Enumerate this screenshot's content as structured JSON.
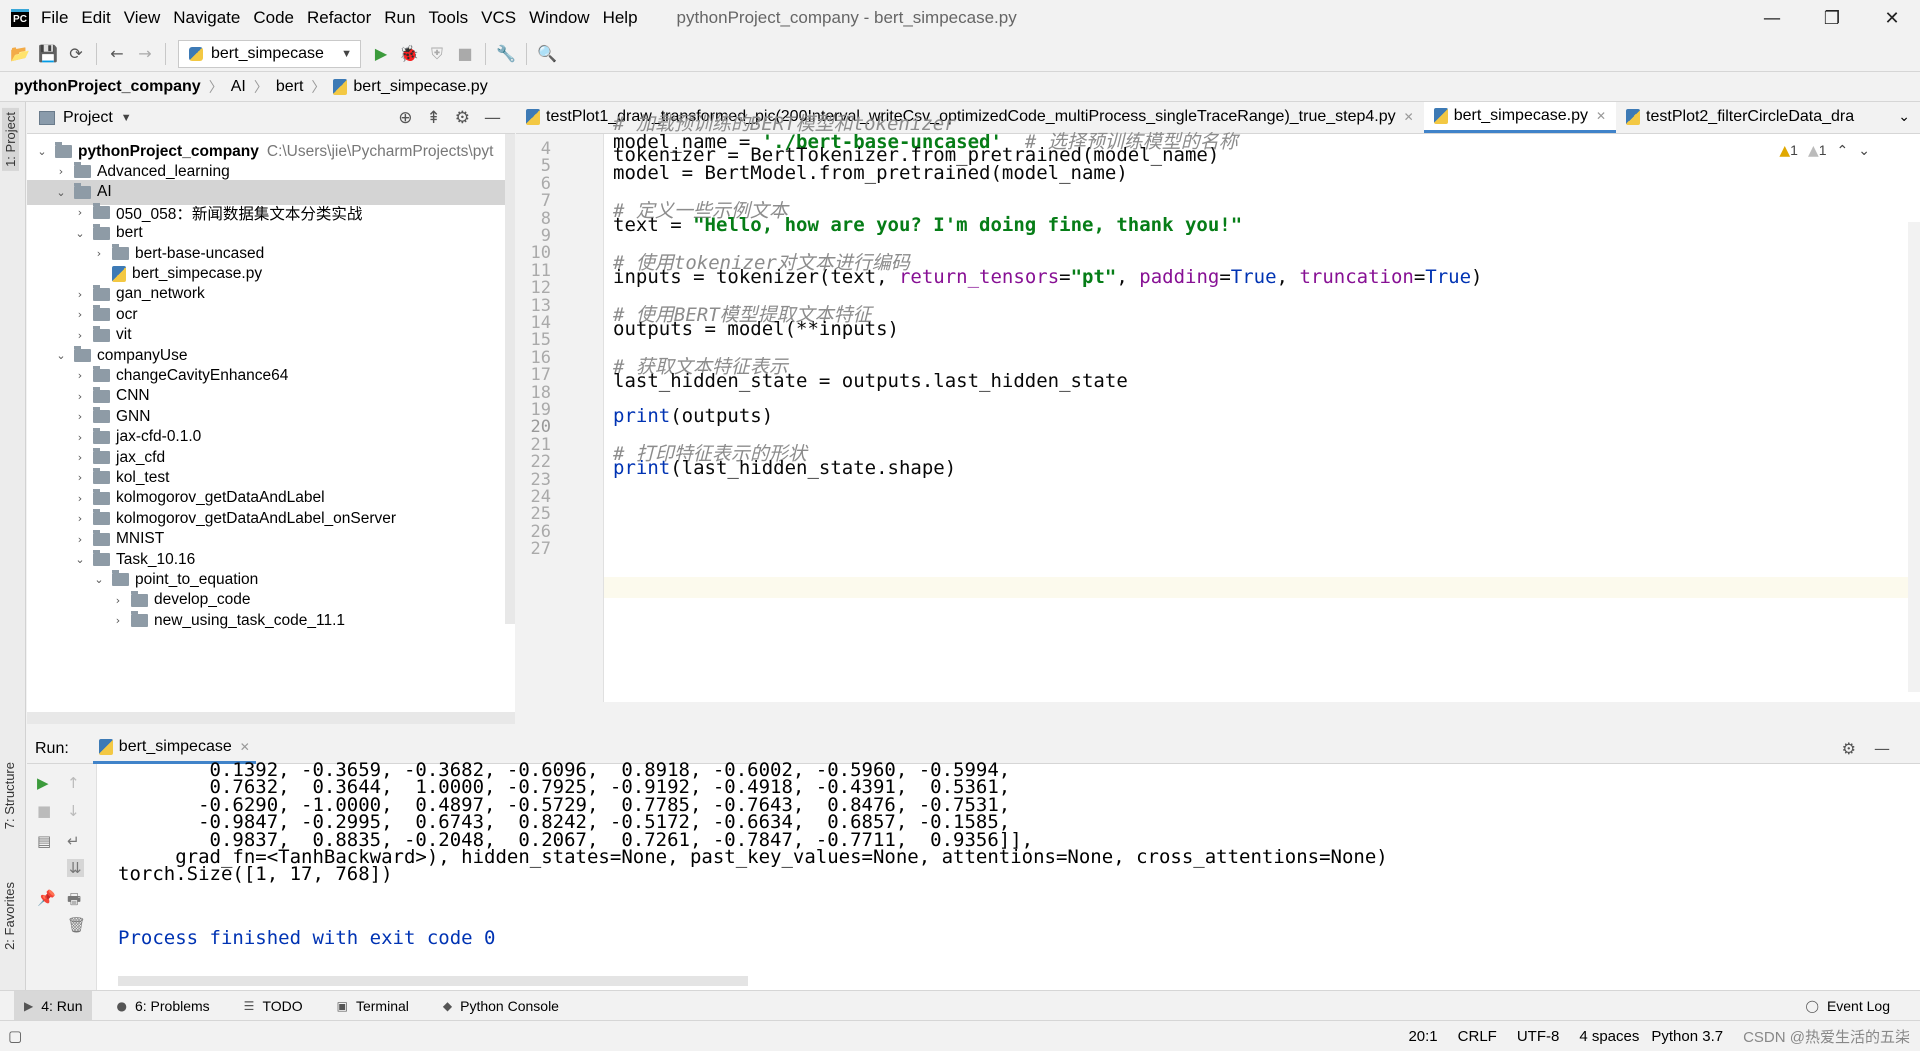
{
  "menubar": {
    "items": [
      "File",
      "Edit",
      "View",
      "Navigate",
      "Code",
      "Refactor",
      "Run",
      "Tools",
      "VCS",
      "Window",
      "Help"
    ],
    "window_title": "pythonProject_company - bert_simpecase.py"
  },
  "toolbar": {
    "run_config": "bert_simpecase"
  },
  "breadcrumb": [
    "pythonProject_company",
    "AI",
    "bert",
    "bert_simpecase.py"
  ],
  "project": {
    "header": "Project",
    "tree": [
      {
        "label": "pythonProject_company",
        "path": "C:\\Users\\jie\\PycharmProjects\\pyt",
        "indent": 0,
        "open": true,
        "type": "folder"
      },
      {
        "label": "Advanced_learning",
        "indent": 1,
        "open": false,
        "type": "folder"
      },
      {
        "label": "AI",
        "indent": 1,
        "open": true,
        "type": "folder"
      },
      {
        "label": "050_058：新闻数据集文本分类实战",
        "indent": 2,
        "open": false,
        "type": "folder"
      },
      {
        "label": "bert",
        "indent": 2,
        "open": true,
        "type": "folder"
      },
      {
        "label": "bert-base-uncased",
        "indent": 3,
        "open": false,
        "type": "folder"
      },
      {
        "label": "bert_simpecase.py",
        "indent": 3,
        "open": null,
        "type": "py"
      },
      {
        "label": "gan_network",
        "indent": 2,
        "open": false,
        "type": "folder"
      },
      {
        "label": "ocr",
        "indent": 2,
        "open": false,
        "type": "folder"
      },
      {
        "label": "vit",
        "indent": 2,
        "open": false,
        "type": "folder"
      },
      {
        "label": "companyUse",
        "indent": 1,
        "open": true,
        "type": "folder"
      },
      {
        "label": "changeCavityEnhance64",
        "indent": 2,
        "open": false,
        "type": "folder"
      },
      {
        "label": "CNN",
        "indent": 2,
        "open": false,
        "type": "folder"
      },
      {
        "label": "GNN",
        "indent": 2,
        "open": false,
        "type": "folder"
      },
      {
        "label": "jax-cfd-0.1.0",
        "indent": 2,
        "open": false,
        "type": "folder"
      },
      {
        "label": "jax_cfd",
        "indent": 2,
        "open": false,
        "type": "folder"
      },
      {
        "label": "kol_test",
        "indent": 2,
        "open": false,
        "type": "folder"
      },
      {
        "label": "kolmogorov_getDataAndLabel",
        "indent": 2,
        "open": false,
        "type": "folder"
      },
      {
        "label": "kolmogorov_getDataAndLabel_onServer",
        "indent": 2,
        "open": false,
        "type": "folder"
      },
      {
        "label": "MNIST",
        "indent": 2,
        "open": false,
        "type": "folder"
      },
      {
        "label": "Task_10.16",
        "indent": 2,
        "open": true,
        "type": "folder"
      },
      {
        "label": "point_to_equation",
        "indent": 3,
        "open": true,
        "type": "folder"
      },
      {
        "label": "develop_code",
        "indent": 4,
        "open": false,
        "type": "folder"
      },
      {
        "label": "new_using_task_code_11.1",
        "indent": 4,
        "open": false,
        "type": "folder"
      }
    ]
  },
  "editor": {
    "tabs": [
      {
        "label": "testPlot1_draw_transformed_pic(200Interval_writeCsv_optimizedCode_multiProcess_singleTraceRange)_true_step4.py",
        "active": false
      },
      {
        "label": "bert_simpecase.py",
        "active": true
      },
      {
        "label": "testPlot2_filterCircleData_dra",
        "active": false
      }
    ],
    "warnings": "1",
    "weak_warnings": "1",
    "line_numbers": [
      "4",
      "5",
      "6",
      "7",
      "8",
      "9",
      "10",
      "11",
      "12",
      "13",
      "14",
      "15",
      "16",
      "17",
      "18",
      "19",
      "20",
      "21",
      "22",
      "23",
      "24",
      "25",
      "26",
      "27"
    ],
    "current_line": "20"
  },
  "run": {
    "label": "Run:",
    "tab": "bert_simpecase",
    "output": [
      "        0.1392, -0.3659, -0.3682, -0.6096,  0.8918, -0.6002, -0.5960, -0.5994,",
      "        0.7632,  0.3644,  1.0000, -0.7925, -0.9192, -0.4918, -0.4391,  0.5361,",
      "       -0.6290, -1.0000,  0.4897, -0.5729,  0.7785, -0.7643,  0.8476, -0.7531,",
      "       -0.9847, -0.2995,  0.6743,  0.8242, -0.5172, -0.6634,  0.6857, -0.1585,",
      "        0.9837,  0.8835, -0.2048,  0.2067,  0.7261, -0.7847, -0.7711,  0.9356]],",
      "     grad_fn=<TanhBackward>), hidden_states=None, past_key_values=None, attentions=None, cross_attentions=None)",
      "torch.Size([1, 17, 768])"
    ],
    "finished": "Process finished with exit code 0"
  },
  "bottom_tabs": [
    "4: Run",
    "6: Problems",
    "TODO",
    "Terminal",
    "Python Console"
  ],
  "event_log": "Event Log",
  "side_tabs": {
    "project": "1: Project",
    "structure": "7: Structure",
    "favorites": "2: Favorites"
  },
  "status": {
    "position": "20:1",
    "line_sep": "CRLF",
    "encoding": "UTF-8",
    "indent": "4 spaces",
    "interpreter": "Python 3.7",
    "watermark": "CSDN @热爱生活的五柒"
  }
}
